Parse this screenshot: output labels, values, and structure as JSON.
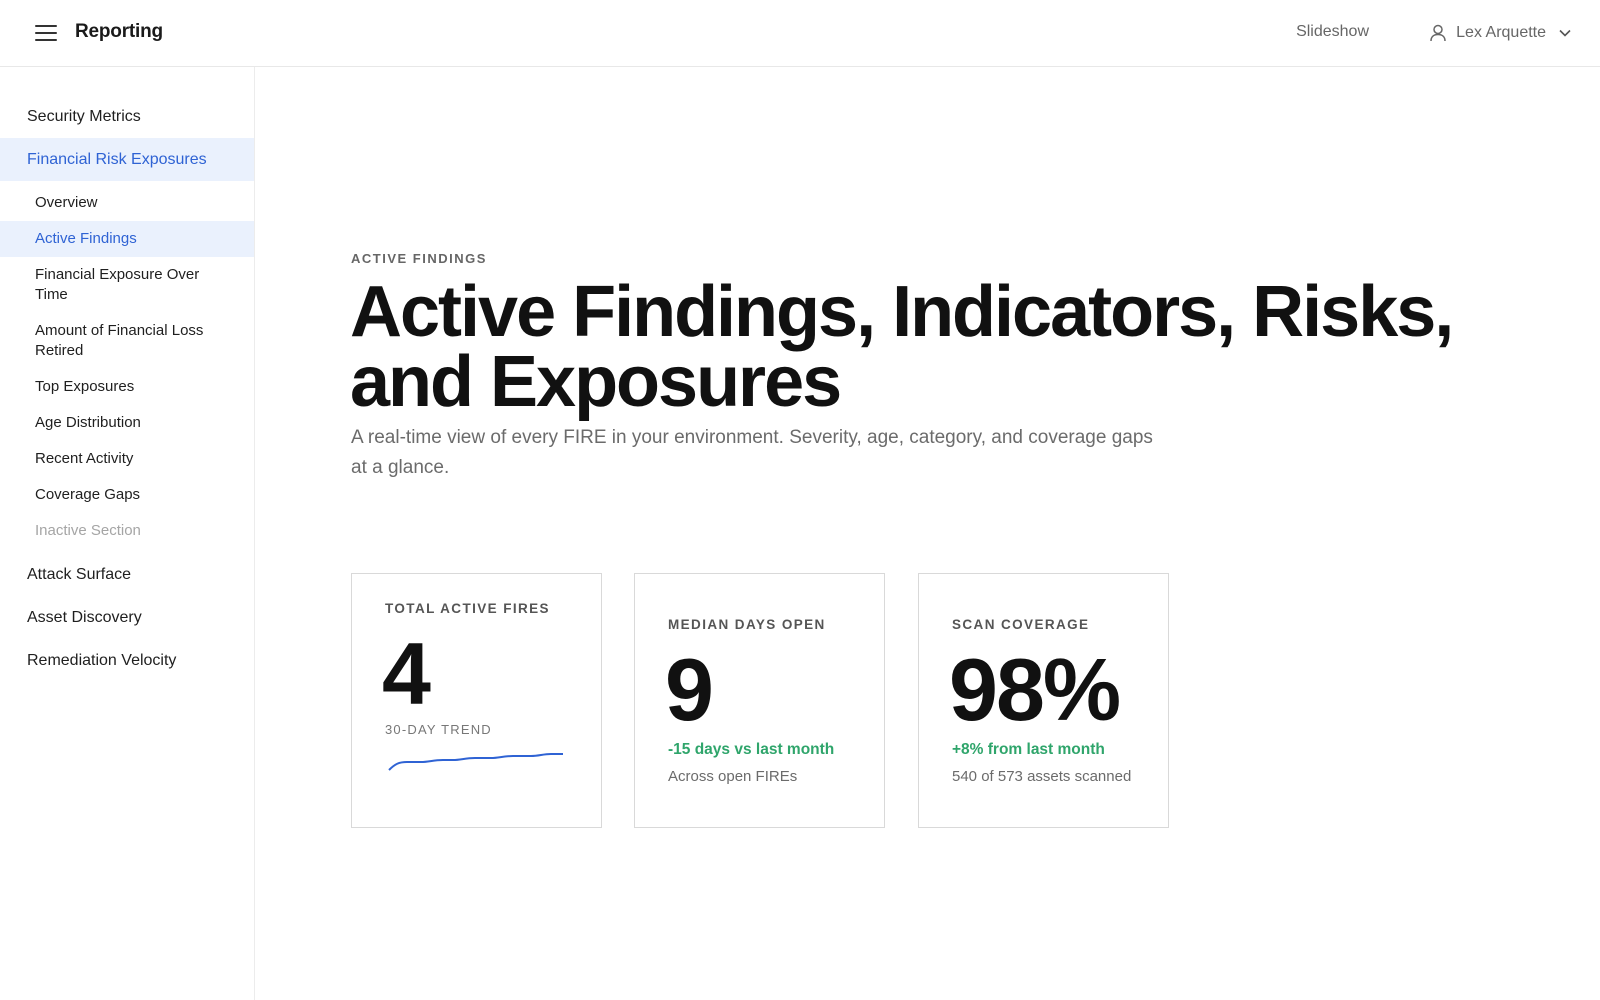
{
  "header": {
    "app_title": "Reporting",
    "slideshow_label": "Slideshow",
    "user_name": "Lex Arquette"
  },
  "sidebar": {
    "items": [
      {
        "label": "Security Metrics"
      },
      {
        "label": "Financial Risk Exposures",
        "active": true
      },
      {
        "label": "Attack Surface"
      },
      {
        "label": "Asset Discovery"
      },
      {
        "label": "Remediation Velocity"
      }
    ],
    "subitems": [
      {
        "label": "Overview"
      },
      {
        "label": "Active Findings",
        "active": true
      },
      {
        "label": "Financial Exposure Over Time"
      },
      {
        "label": "Amount of Financial Loss Retired"
      },
      {
        "label": "Top Exposures"
      },
      {
        "label": "Age Distribution"
      },
      {
        "label": "Recent Activity"
      },
      {
        "label": "Coverage Gaps"
      },
      {
        "label": "Inactive Section",
        "disabled": true
      }
    ]
  },
  "main": {
    "eyebrow": "ACTIVE FINDINGS",
    "title": "Active Findings, Indicators, Risks, and Exposures",
    "description": "A real-time view of every FIRE in your environment. Severity, age, category, and coverage gaps at a glance."
  },
  "cards": {
    "total": {
      "label": "TOTAL ACTIVE FIRES",
      "value": "4",
      "trend_label": "30-DAY TREND",
      "trend_color": "#2f63d4"
    },
    "median": {
      "label": "MEDIAN DAYS OPEN",
      "value": "9",
      "delta": "-15 days vs last month",
      "note": "Across open FIREs"
    },
    "coverage": {
      "label": "SCAN COVERAGE",
      "value": "98%",
      "delta": "+8% from last month",
      "note": "540 of 573 assets scanned"
    }
  },
  "colors": {
    "accent": "#2f63d4",
    "active_bg": "#eaf1fd",
    "positive": "#2fa56b"
  }
}
